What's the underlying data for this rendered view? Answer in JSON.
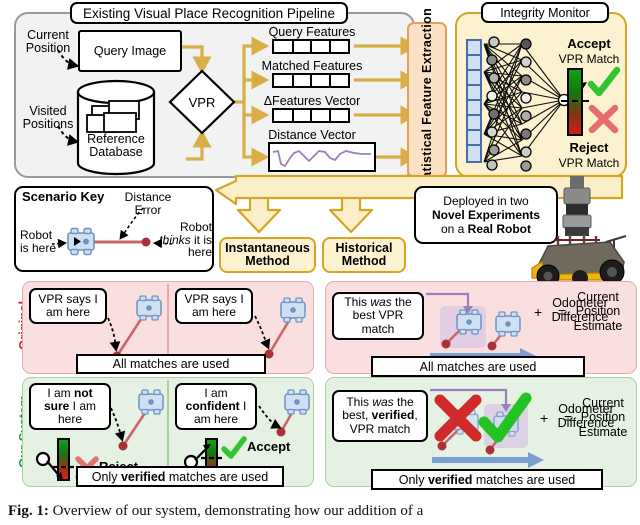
{
  "pipeline": {
    "title": "Existing Visual Place Recognition Pipeline",
    "inputs": [
      {
        "label": "Current\nPosition"
      },
      {
        "label": "Visited\nPositions"
      }
    ],
    "current_position": "Current Position",
    "visited_positions": "Visited Positions",
    "query_image": "Query Image",
    "reference_database": "Reference Database",
    "vpr": "VPR",
    "vectors": [
      {
        "label": "Query Features",
        "kind": "boxes"
      },
      {
        "label": "Matched Features",
        "kind": "boxes"
      },
      {
        "label": "ΔFeatures Vector",
        "kind": "boxes"
      },
      {
        "label": "Distance Vector",
        "kind": "curve"
      }
    ]
  },
  "sfe": {
    "label": "Statistical Feature Extraction"
  },
  "integrity": {
    "title": "Integrity Monitor",
    "accept_bold": "Accept",
    "accept_sub": "VPR Match",
    "reject_bold": "Reject",
    "reject_sub": "VPR Match",
    "accept_icon": "check-icon",
    "reject_icon": "cross-icon"
  },
  "scenario_key": {
    "title": "Scenario Key",
    "distance_error": "Distance Error",
    "robot_is_here": "Robot is here",
    "robot_thinks_pre": "Robot ",
    "robot_thinks_em": "thinks",
    "robot_thinks_post": " it is here"
  },
  "methods": [
    {
      "label": "Instantaneous Method"
    },
    {
      "label": "Historical Method"
    }
  ],
  "deployed": {
    "line1": "Deployed in two",
    "line2": "Novel Experiments",
    "line3_pre": "on a ",
    "line3_bold": "Real Robot",
    "robot_photo": "real-robot-photo"
  },
  "row_labels": {
    "original": "Original",
    "ours": "Our System"
  },
  "instantaneous": {
    "original": {
      "cells": [
        {
          "speech": "VPR says I am here"
        },
        {
          "speech": "VPR says I am here"
        }
      ],
      "banner": "All matches are used"
    },
    "ours": {
      "cells": [
        {
          "speech_pre": "I am ",
          "speech_bold": "not sure",
          "speech_post": " I am here",
          "verdict": "Reject",
          "verdict_icon": "cross-icon"
        },
        {
          "speech_pre": "I am ",
          "speech_bold": "confident",
          "speech_post": " I am here",
          "verdict": "Accept",
          "verdict_icon": "check-icon"
        }
      ],
      "banner_pre": "Only ",
      "banner_bold": "verified",
      "banner_post": " matches are used"
    }
  },
  "historical": {
    "original": {
      "speech_pre": "This ",
      "speech_em": "was",
      "speech_post": " the best VPR match",
      "plus": "+",
      "odometer": "Odometer Difference",
      "equals": "=",
      "result": "Current Position Estimate",
      "banner": "All matches are used"
    },
    "ours": {
      "speech_pre": "This ",
      "speech_em": "was",
      "speech_mid": " the best, ",
      "speech_bold": "verified",
      "speech_post": ", VPR match",
      "plus": "+",
      "odometer": "Odometer Difference",
      "equals": "=",
      "result": "Current Position Estimate",
      "banner_pre": "Only ",
      "banner_bold": "verified",
      "banner_post": " matches are used",
      "reject_icon": "cross-icon",
      "accept_icon": "check-icon"
    }
  },
  "caption": {
    "figno": "Fig. 1:",
    "text": " Overview of our system, demonstrating how our addition of a"
  },
  "colors": {
    "pipeline_bg": "#f2f2f2",
    "sfe_bg": "#fde1c4",
    "integrity_bg": "#fdf2cf",
    "gold": "#d4a521",
    "arrow_gold": "#d8ae47",
    "pink": "#fadfe0",
    "green": "#e5f1e2",
    "original_text": "#c0232b",
    "ours_text": "#1b9e2f",
    "robot_blue": "#b9cfe8",
    "error_red": "#b5383c",
    "purple": "#9b7fbe",
    "odo_blue": "#7b9fd0",
    "check_green": "#2fbf2f",
    "cross_red": "#e04a4a"
  }
}
